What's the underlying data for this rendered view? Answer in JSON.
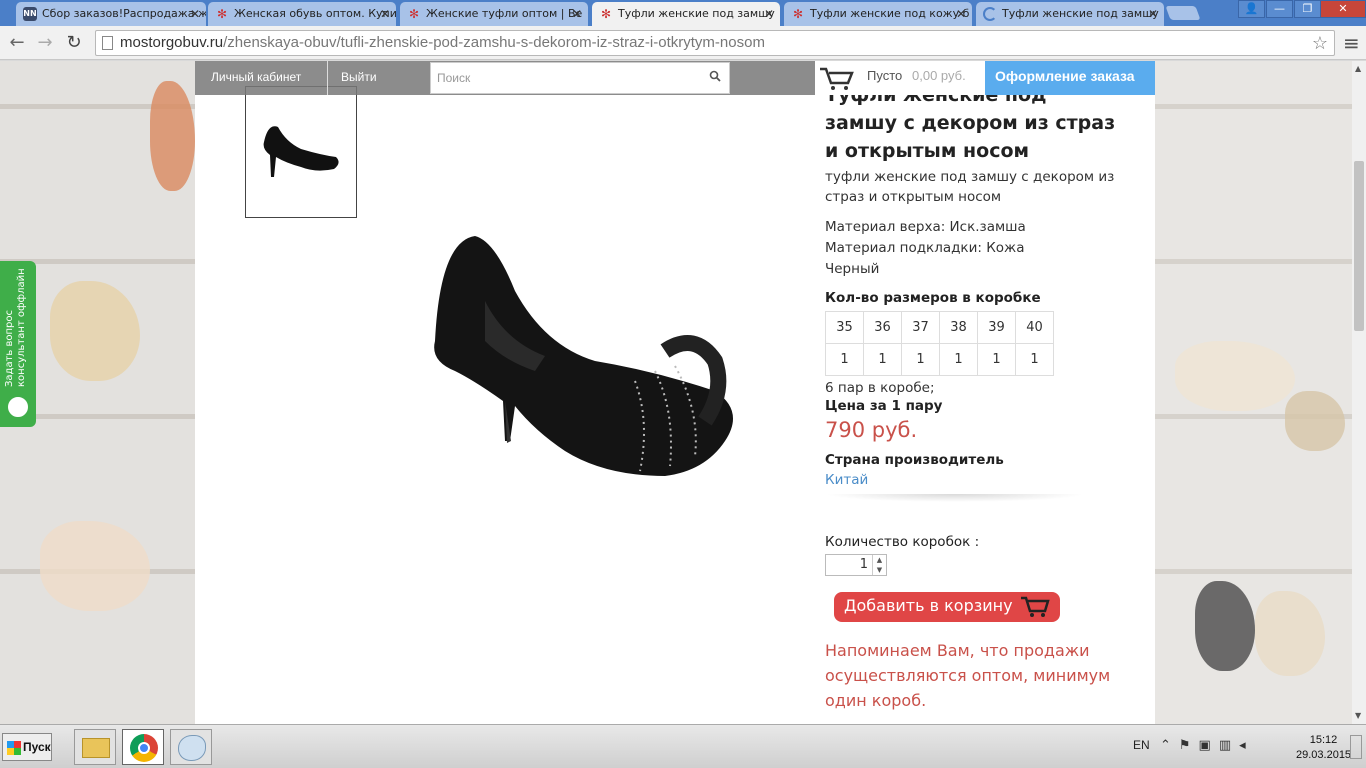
{
  "browser": {
    "tabs": [
      {
        "label": "Сбор заказов!Распродажа ж",
        "favicon": "NN",
        "active": false
      },
      {
        "label": "Женская обувь оптом. Купи",
        "favicon": "flower",
        "active": false
      },
      {
        "label": "Женские туфли оптом | Ве",
        "favicon": "flower",
        "active": false
      },
      {
        "label": "Туфли женские под замшу",
        "favicon": "flower",
        "active": true
      },
      {
        "label": "Туфли женские под кожу б",
        "favicon": "flower",
        "active": false
      },
      {
        "label": "Туфли женские под замшу",
        "favicon": "loading",
        "active": false
      }
    ],
    "url_host": "mostorgobuv.ru",
    "url_path": "/zhenskaya-obuv/tufli-zhenskie-pod-zamshu-s-dekorom-iz-straz-i-otkrytym-nosom"
  },
  "header": {
    "account_link": "Личный кабинет",
    "logout_link": "Выйти",
    "search_placeholder": "Поиск",
    "cart_status": "Пусто",
    "cart_sum": "0,00 руб.",
    "checkout_label": "Оформление заказа"
  },
  "product": {
    "title": "Туфли женские под замшу с декором из страз и открытым носом",
    "subtitle": "туфли женские под замшу с декором из страз и открытым носом",
    "material_upper": "Материал верха: Иск.замша",
    "material_lining": "Материал подкладки: Кожа",
    "color": "Черный",
    "sizes_heading": "Кол-во размеров в коробке",
    "sizes": [
      "35",
      "36",
      "37",
      "38",
      "39",
      "40"
    ],
    "size_counts": [
      "1",
      "1",
      "1",
      "1",
      "1",
      "1"
    ],
    "pairs_text": "6 пар в коробе;",
    "price_heading": "Цена за 1 пару",
    "price": "790 руб.",
    "country_heading": "Страна производитель",
    "country": "Китай",
    "qty_heading": "Количество коробок :",
    "qty_value": "1",
    "add_to_cart": "Добавить в корзину",
    "notice": "Напоминаем Вам, что продажи осуществляются оптом, минимум один короб."
  },
  "side_widget": {
    "line1": "Задать вопрос",
    "line2": "консультант оффлайн"
  },
  "taskbar": {
    "start_label": "Пуск",
    "lang": "EN",
    "time": "15:12",
    "date": "29.03.2015"
  },
  "colors": {
    "accent_blue": "#5aacee",
    "price_red": "#c9514a",
    "button_red": "#e04646",
    "widget_green": "#3fae49"
  }
}
